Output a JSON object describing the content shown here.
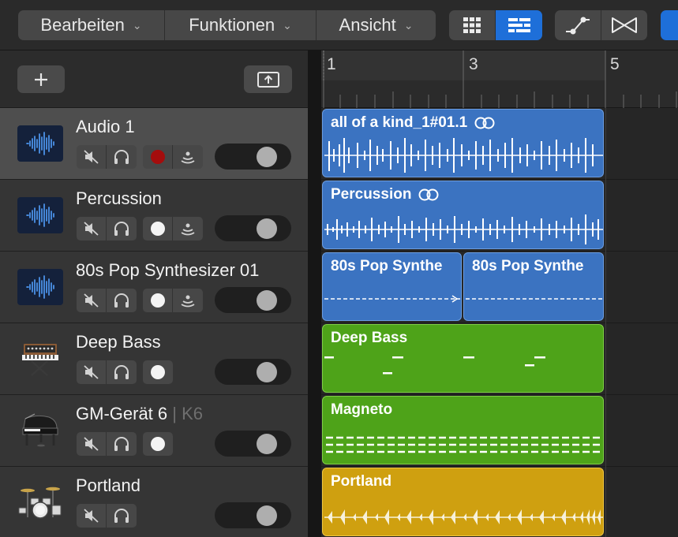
{
  "menu": [
    {
      "label": "Bearbeiten"
    },
    {
      "label": "Funktionen"
    },
    {
      "label": "Ansicht"
    }
  ],
  "toolbar_icons": [
    "grid-view-icon",
    "list-view-icon",
    "automation-curve-icon",
    "flex-time-icon"
  ],
  "ruler": {
    "bars": [
      "1",
      "3",
      "5"
    ]
  },
  "tracks": [
    {
      "name": "Audio 1",
      "subname": "",
      "icon": "audio-waveform-icon",
      "selected": true,
      "record_armed": true,
      "input_monitor": true,
      "record_button": true
    },
    {
      "name": "Percussion",
      "subname": "",
      "icon": "audio-waveform-icon",
      "selected": false,
      "record_armed": false,
      "input_monitor": true,
      "record_button": true
    },
    {
      "name": "80s Pop Synthesizer 01",
      "subname": "",
      "icon": "audio-waveform-icon",
      "selected": false,
      "record_armed": false,
      "input_monitor": true,
      "record_button": true
    },
    {
      "name": "Deep Bass",
      "subname": "",
      "icon": "synthesizer-icon",
      "selected": false,
      "record_armed": false,
      "input_monitor": false,
      "record_button": true
    },
    {
      "name": "GM-Gerät 6",
      "subname": "K6",
      "icon": "grand-piano-icon",
      "selected": false,
      "record_armed": false,
      "input_monitor": false,
      "record_button": true
    },
    {
      "name": "Portland",
      "subname": "",
      "icon": "drum-kit-icon",
      "selected": false,
      "record_armed": false,
      "input_monitor": false,
      "record_button": false
    }
  ],
  "regions": [
    {
      "title": "all of a kind_1#01.1",
      "loop": true,
      "color": "#3b73c1"
    },
    {
      "title": "Percussion",
      "loop": true,
      "color": "#3b73c1"
    },
    {
      "title": "80s Pop Synthe",
      "loop": false,
      "color": "#3b73c1"
    },
    {
      "title": "80s Pop Synthe",
      "loop": false,
      "color": "#3b73c1"
    },
    {
      "title": "Deep Bass",
      "loop": false,
      "color": "#4ea319"
    },
    {
      "title": "Magneto",
      "loop": false,
      "color": "#4ea319"
    },
    {
      "title": "Portland",
      "loop": false,
      "color": "#cfa010"
    }
  ],
  "colors": {
    "accent": "#1e6fd9",
    "audio_region": "#3b73c1",
    "midi_region": "#4ea319",
    "drummer_region": "#cfa010",
    "record_armed": "#a40d0d"
  }
}
